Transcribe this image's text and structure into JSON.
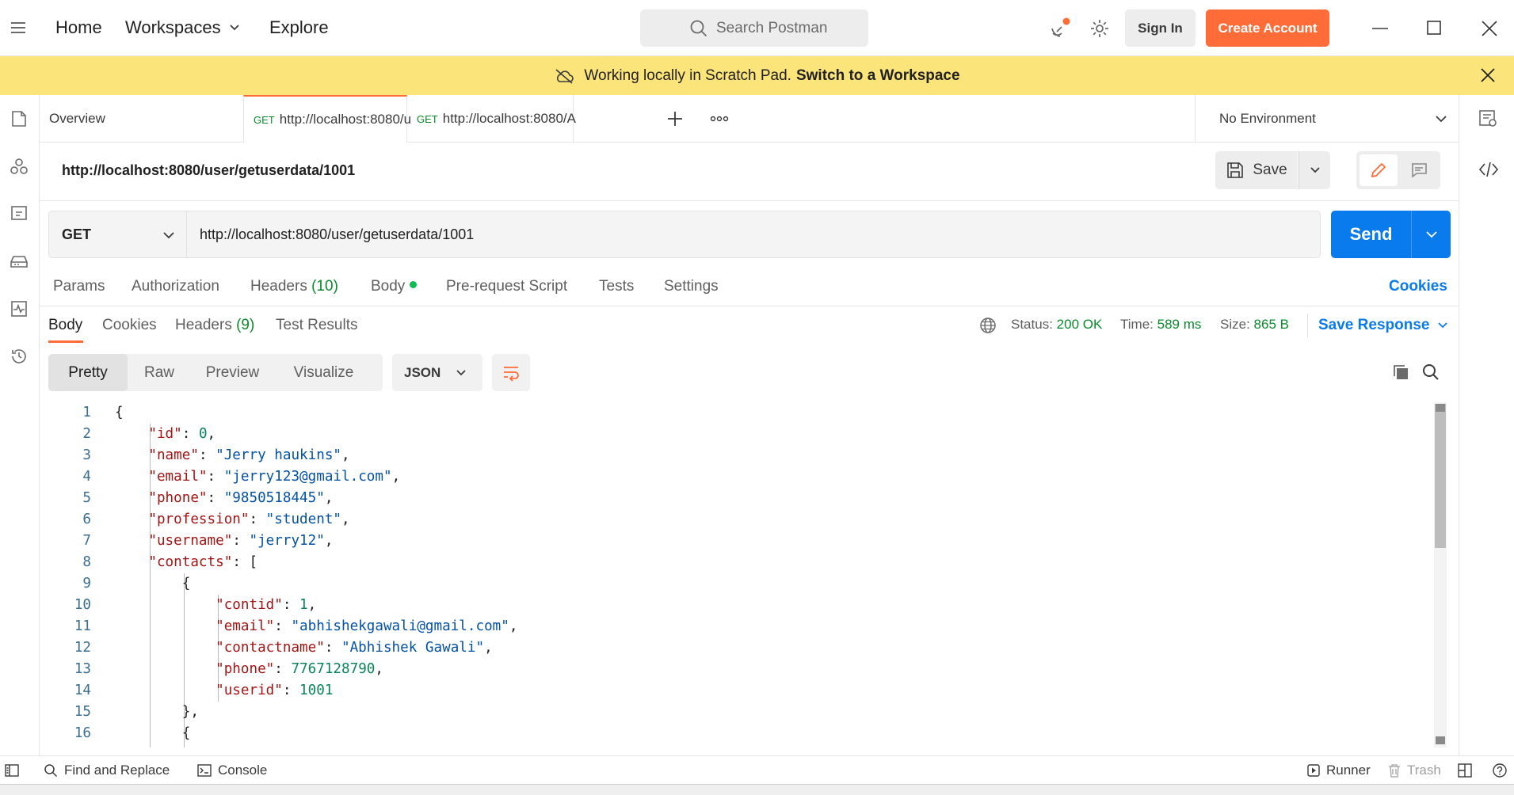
{
  "topbar": {
    "nav": [
      "Home",
      "Workspaces",
      "Explore"
    ],
    "search_placeholder": "Search Postman",
    "sign_in": "Sign In",
    "create_account": "Create Account"
  },
  "banner": {
    "text": "Working locally in Scratch Pad.",
    "link": "Switch to a Workspace"
  },
  "tabs": [
    {
      "method": "GET",
      "label": "http://localhost:8080/u"
    },
    {
      "method": "GET",
      "label": "http://localhost:8080/A"
    }
  ],
  "tab_overview": "Overview",
  "environment": "No Environment",
  "request": {
    "title": "http://localhost:8080/user/getuserdata/1001",
    "save_label": "Save",
    "method": "GET",
    "url": "http://localhost:8080/user/getuserdata/1001",
    "send_label": "Send"
  },
  "request_tabs": {
    "params": "Params",
    "authorization": "Authorization",
    "headers": "Headers",
    "headers_count": "(10)",
    "body": "Body",
    "prerequest": "Pre-request Script",
    "tests": "Tests",
    "settings": "Settings",
    "cookies_link": "Cookies"
  },
  "response": {
    "tabs": {
      "body": "Body",
      "cookies": "Cookies",
      "headers": "Headers",
      "headers_count": "(9)",
      "test_results": "Test Results"
    },
    "status_label": "Status:",
    "status_value": "200 OK",
    "time_label": "Time:",
    "time_value": "589 ms",
    "size_label": "Size:",
    "size_value": "865 B",
    "save_response": "Save Response",
    "views": [
      "Pretty",
      "Raw",
      "Preview",
      "Visualize"
    ],
    "format": "JSON"
  },
  "code_lines": [
    "{",
    "    \"id\": 0,",
    "    \"name\": \"Jerry haukins\",",
    "    \"email\": \"jerry123@gmail.com\",",
    "    \"phone\": \"9850518445\",",
    "    \"profession\": \"student\",",
    "    \"username\": \"jerry12\",",
    "    \"contacts\": [",
    "        {",
    "            \"contid\": 1,",
    "            \"email\": \"abhishekgawali@gmail.com\",",
    "            \"contactname\": \"Abhishek Gawali\",",
    "            \"phone\": 7767128790,",
    "            \"userid\": 1001",
    "        },",
    "        {"
  ],
  "statusbar": {
    "find_replace": "Find and Replace",
    "console": "Console",
    "runner": "Runner",
    "trash": "Trash"
  },
  "colors": {
    "accent": "#ff6c37",
    "send": "#097bed",
    "banner": "#fbe47a",
    "status_ok": "#0b8a2d"
  }
}
